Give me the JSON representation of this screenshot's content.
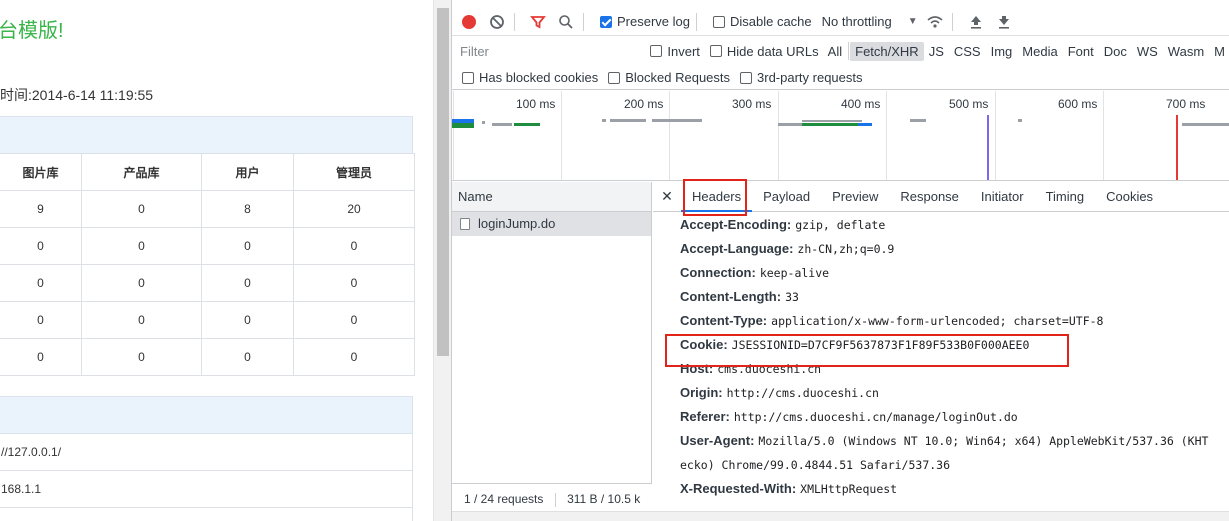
{
  "left": {
    "welcome": "台模版!",
    "login_time_label": "时间:",
    "login_time": "2014-6-14 11:19:55",
    "stats_headers": [
      "图片库",
      "产品库",
      "用户",
      "管理员"
    ],
    "stats_rows": [
      [
        "9",
        "0",
        "8",
        "20"
      ],
      [
        "0",
        "0",
        "0",
        "0"
      ],
      [
        "0",
        "0",
        "0",
        "0"
      ],
      [
        "0",
        "0",
        "0",
        "0"
      ],
      [
        "0",
        "0",
        "0",
        "0"
      ]
    ],
    "info_rows": [
      "//127.0.0.1/",
      "168.1.1"
    ]
  },
  "toolbar": {
    "preserve_log": "Preserve log",
    "disable_cache": "Disable cache",
    "throttling": "No throttling"
  },
  "filter": {
    "placeholder": "Filter",
    "invert": "Invert",
    "hide_data_urls": "Hide data URLs",
    "types": [
      "All",
      "Fetch/XHR",
      "JS",
      "CSS",
      "Img",
      "Media",
      "Font",
      "Doc",
      "WS",
      "Wasm",
      "M"
    ],
    "active_type": "Fetch/XHR",
    "blocked_cookies": "Has blocked cookies",
    "blocked_requests": "Blocked Requests",
    "third_party": "3rd-party requests"
  },
  "timeline": {
    "ticks": [
      "100 ms",
      "200 ms",
      "300 ms",
      "400 ms",
      "500 ms",
      "600 ms",
      "700 ms"
    ]
  },
  "requests": {
    "column_name": "Name",
    "items": [
      "loginJump.do"
    ],
    "status_count": "1 / 24 requests",
    "status_size": "311 B / 10.5 k"
  },
  "detail": {
    "tabs": [
      "Headers",
      "Payload",
      "Preview",
      "Response",
      "Initiator",
      "Timing",
      "Cookies"
    ],
    "active_tab": "Headers",
    "headers": [
      {
        "name": "Accept-Encoding:",
        "value": "gzip, deflate"
      },
      {
        "name": "Accept-Language:",
        "value": "zh-CN,zh;q=0.9"
      },
      {
        "name": "Connection:",
        "value": "keep-alive"
      },
      {
        "name": "Content-Length:",
        "value": "33"
      },
      {
        "name": "Content-Type:",
        "value": "application/x-www-form-urlencoded; charset=UTF-8"
      },
      {
        "name": "Cookie:",
        "value": "JSESSIONID=D7CF9F5637873F1F89F533B0F000AEE0"
      },
      {
        "name": "Host:",
        "value": "cms.duoceshi.cn"
      },
      {
        "name": "Origin:",
        "value": "http://cms.duoceshi.cn"
      },
      {
        "name": "Referer:",
        "value": "http://cms.duoceshi.cn/manage/loginOut.do"
      },
      {
        "name": "User-Agent:",
        "value": "Mozilla/5.0 (Windows NT 10.0; Win64; x64) AppleWebKit/537.36 (KHT"
      },
      {
        "name": "",
        "value": "ecko) Chrome/99.0.4844.51 Safari/537.36"
      },
      {
        "name": "X-Requested-With:",
        "value": "XMLHttpRequest"
      }
    ]
  },
  "colors": {
    "accent": "#1a73e8",
    "record": "#e53935",
    "highlight_box": "#e2231a",
    "welcome": "#3ab54a"
  }
}
